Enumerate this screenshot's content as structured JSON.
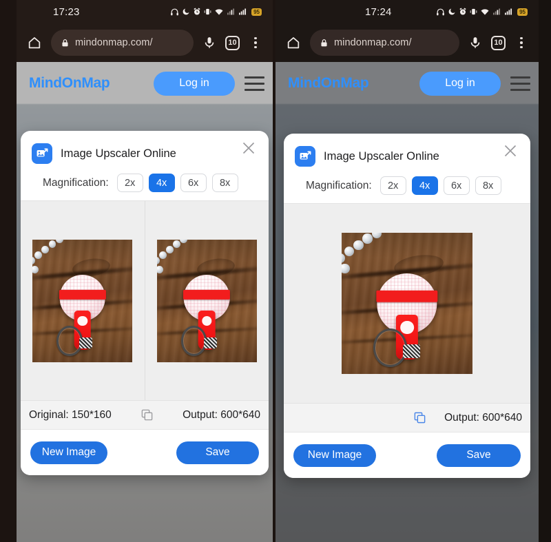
{
  "panels": [
    {
      "status": {
        "time": "17:23",
        "battery": "95",
        "icons": [
          "headphones-icon",
          "moon-icon",
          "alarm-icon",
          "vibrate-icon",
          "wifi-icon",
          "signal-icon",
          "signal-icon",
          "battery-icon"
        ]
      },
      "browser": {
        "url": "mindonmap.com/",
        "tab_count": "10",
        "icons": [
          "home-icon",
          "lock-icon",
          "mic-icon",
          "tab-count-icon",
          "overflow-menu-icon"
        ]
      },
      "site": {
        "logo": "MindOnMap",
        "login_label": "Log in"
      },
      "dialog": {
        "title": "Image Upscaler Online",
        "magnification_label": "Magnification:",
        "magnifications": [
          "2x",
          "4x",
          "6x",
          "8x"
        ],
        "selected_magnification": "4x",
        "original_label": "Original: 150*160",
        "output_label": "Output: 600*640",
        "show_original": true,
        "compare_panes": 2,
        "copy_icon_active": false,
        "new_image_label": "New Image",
        "save_label": "Save"
      }
    },
    {
      "status": {
        "time": "17:24",
        "battery": "95",
        "icons": [
          "headphones-icon",
          "moon-icon",
          "alarm-icon",
          "vibrate-icon",
          "wifi-icon",
          "signal-icon",
          "signal-icon",
          "battery-icon"
        ]
      },
      "browser": {
        "url": "mindonmap.com/",
        "tab_count": "10",
        "icons": [
          "home-icon",
          "lock-icon",
          "mic-icon",
          "tab-count-icon",
          "overflow-menu-icon"
        ]
      },
      "site": {
        "logo": "MindOnMap",
        "login_label": "Log in"
      },
      "dialog": {
        "title": "Image Upscaler Online",
        "magnification_label": "Magnification:",
        "magnifications": [
          "2x",
          "4x",
          "6x",
          "8x"
        ],
        "selected_magnification": "4x",
        "original_label": "",
        "output_label": "Output: 600*640",
        "show_original": false,
        "compare_panes": 1,
        "copy_icon_active": true,
        "new_image_label": "New Image",
        "save_label": "Save"
      }
    }
  ],
  "colors": {
    "accent_blue": "#2272e0",
    "logo_blue": "#2f8ffb",
    "selected_mag": "#1a73e8",
    "battery_amber": "#d6a328",
    "status_bg": "#241b17"
  }
}
